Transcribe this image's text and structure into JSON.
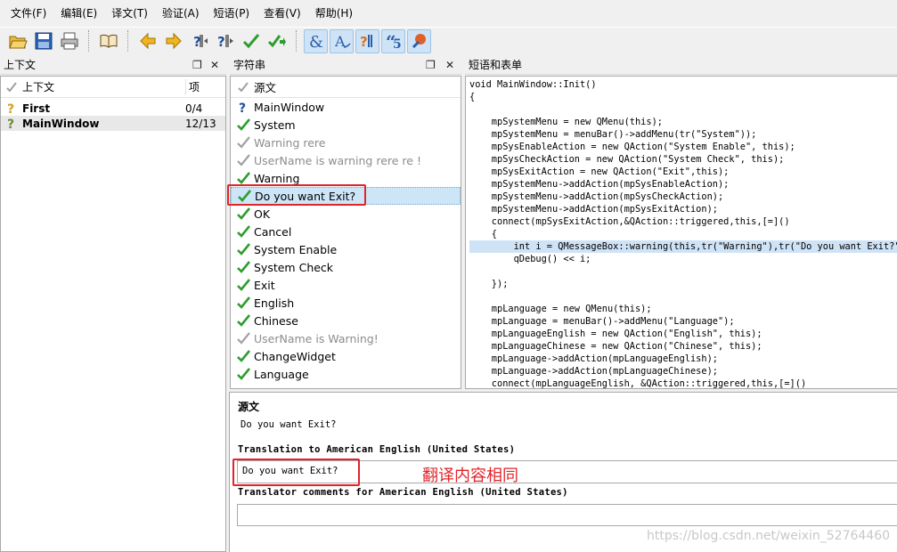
{
  "menu": [
    "文件(F)",
    "编辑(E)",
    "译文(T)",
    "验证(A)",
    "短语(P)",
    "查看(V)",
    "帮助(H)"
  ],
  "toolbar": {
    "icons": [
      "open-folder-icon",
      "save-icon",
      "print-icon",
      "book-icon",
      "arrow-left-icon",
      "arrow-right-icon",
      "prev-unfinished-icon",
      "next-unfinished-icon",
      "done-check-icon",
      "done-next-icon",
      "accelerator-icon",
      "ending-punctuation-icon",
      "phrase-match-icon",
      "quote-icon",
      "place-marker-icon"
    ]
  },
  "context_panel": {
    "title": "上下文",
    "col_context": "上下文",
    "col_items": "项",
    "rows": [
      {
        "name": "First",
        "count": "0/4"
      },
      {
        "name": "MainWindow",
        "count": "12/13"
      }
    ]
  },
  "strings_panel": {
    "title": "字符串",
    "col_source": "源文",
    "items": [
      {
        "text": "MainWindow",
        "state": "question"
      },
      {
        "text": "System",
        "state": "done"
      },
      {
        "text": "Warning rere",
        "state": "obsolete"
      },
      {
        "text": "UserName is warning rere re !",
        "state": "obsolete"
      },
      {
        "text": "Warning",
        "state": "done"
      },
      {
        "text": "Do you want Exit?",
        "state": "done"
      },
      {
        "text": "OK",
        "state": "done"
      },
      {
        "text": "Cancel",
        "state": "done"
      },
      {
        "text": "System Enable",
        "state": "done"
      },
      {
        "text": "System Check",
        "state": "done"
      },
      {
        "text": "Exit",
        "state": "done"
      },
      {
        "text": "English",
        "state": "done"
      },
      {
        "text": "Chinese",
        "state": "done"
      },
      {
        "text": "UserName is Warning!",
        "state": "obsolete"
      },
      {
        "text": "ChangeWidget",
        "state": "done"
      },
      {
        "text": "Language",
        "state": "done"
      }
    ]
  },
  "phrases_panel": {
    "title": "短语和表单",
    "code_lines": [
      "void MainWindow::Init()",
      "{",
      "",
      "    mpSystemMenu = new QMenu(this);",
      "    mpSystemMenu = menuBar()->addMenu(tr(\"System\"));",
      "    mpSysEnableAction = new QAction(\"System Enable\", this);",
      "    mpSysCheckAction = new QAction(\"System Check\", this);",
      "    mpSysExitAction = new QAction(\"Exit\",this);",
      "    mpSystemMenu->addAction(mpSysEnableAction);",
      "    mpSystemMenu->addAction(mpSysCheckAction);",
      "    mpSystemMenu->addAction(mpSysExitAction);",
      "    connect(mpSysExitAction,&QAction::triggered,this,[=]()",
      "    {",
      "        int i = QMessageBox::warning(this,tr(\"Warning\"),tr(\"Do you want Exit?\"),",
      "        qDebug() << i;",
      "",
      "    });",
      "",
      "    mpLanguage = new QMenu(this);",
      "    mpLanguage = menuBar()->addMenu(\"Language\");",
      "    mpLanguageEnglish = new QAction(\"English\", this);",
      "    mpLanguageChinese = new QAction(\"Chinese\", this);",
      "    mpLanguage->addAction(mpLanguageEnglish);",
      "    mpLanguage->addAction(mpLanguageChinese);",
      "    connect(mpLanguageEnglish, &QAction::triggered,this,[=]()",
      "    {"
    ],
    "highlight_line": 13
  },
  "editor": {
    "source_label": "源文",
    "source_text": "Do you want Exit?",
    "translation_label": "Translation to American English (United States)",
    "translation_value": "Do you want Exit?",
    "comments_label": "Translator comments for American English (United States)",
    "comments_value": ""
  },
  "annotation": "翻译内容相同",
  "watermark": "https://blog.csdn.net/weixin_52764460",
  "colors": {
    "check_green": "#2e9d2e",
    "grey_check": "#a0a0a0",
    "question_gold": "#d4a017",
    "highlight_red": "#e0242a",
    "selection_blue": "#cde6f7"
  }
}
